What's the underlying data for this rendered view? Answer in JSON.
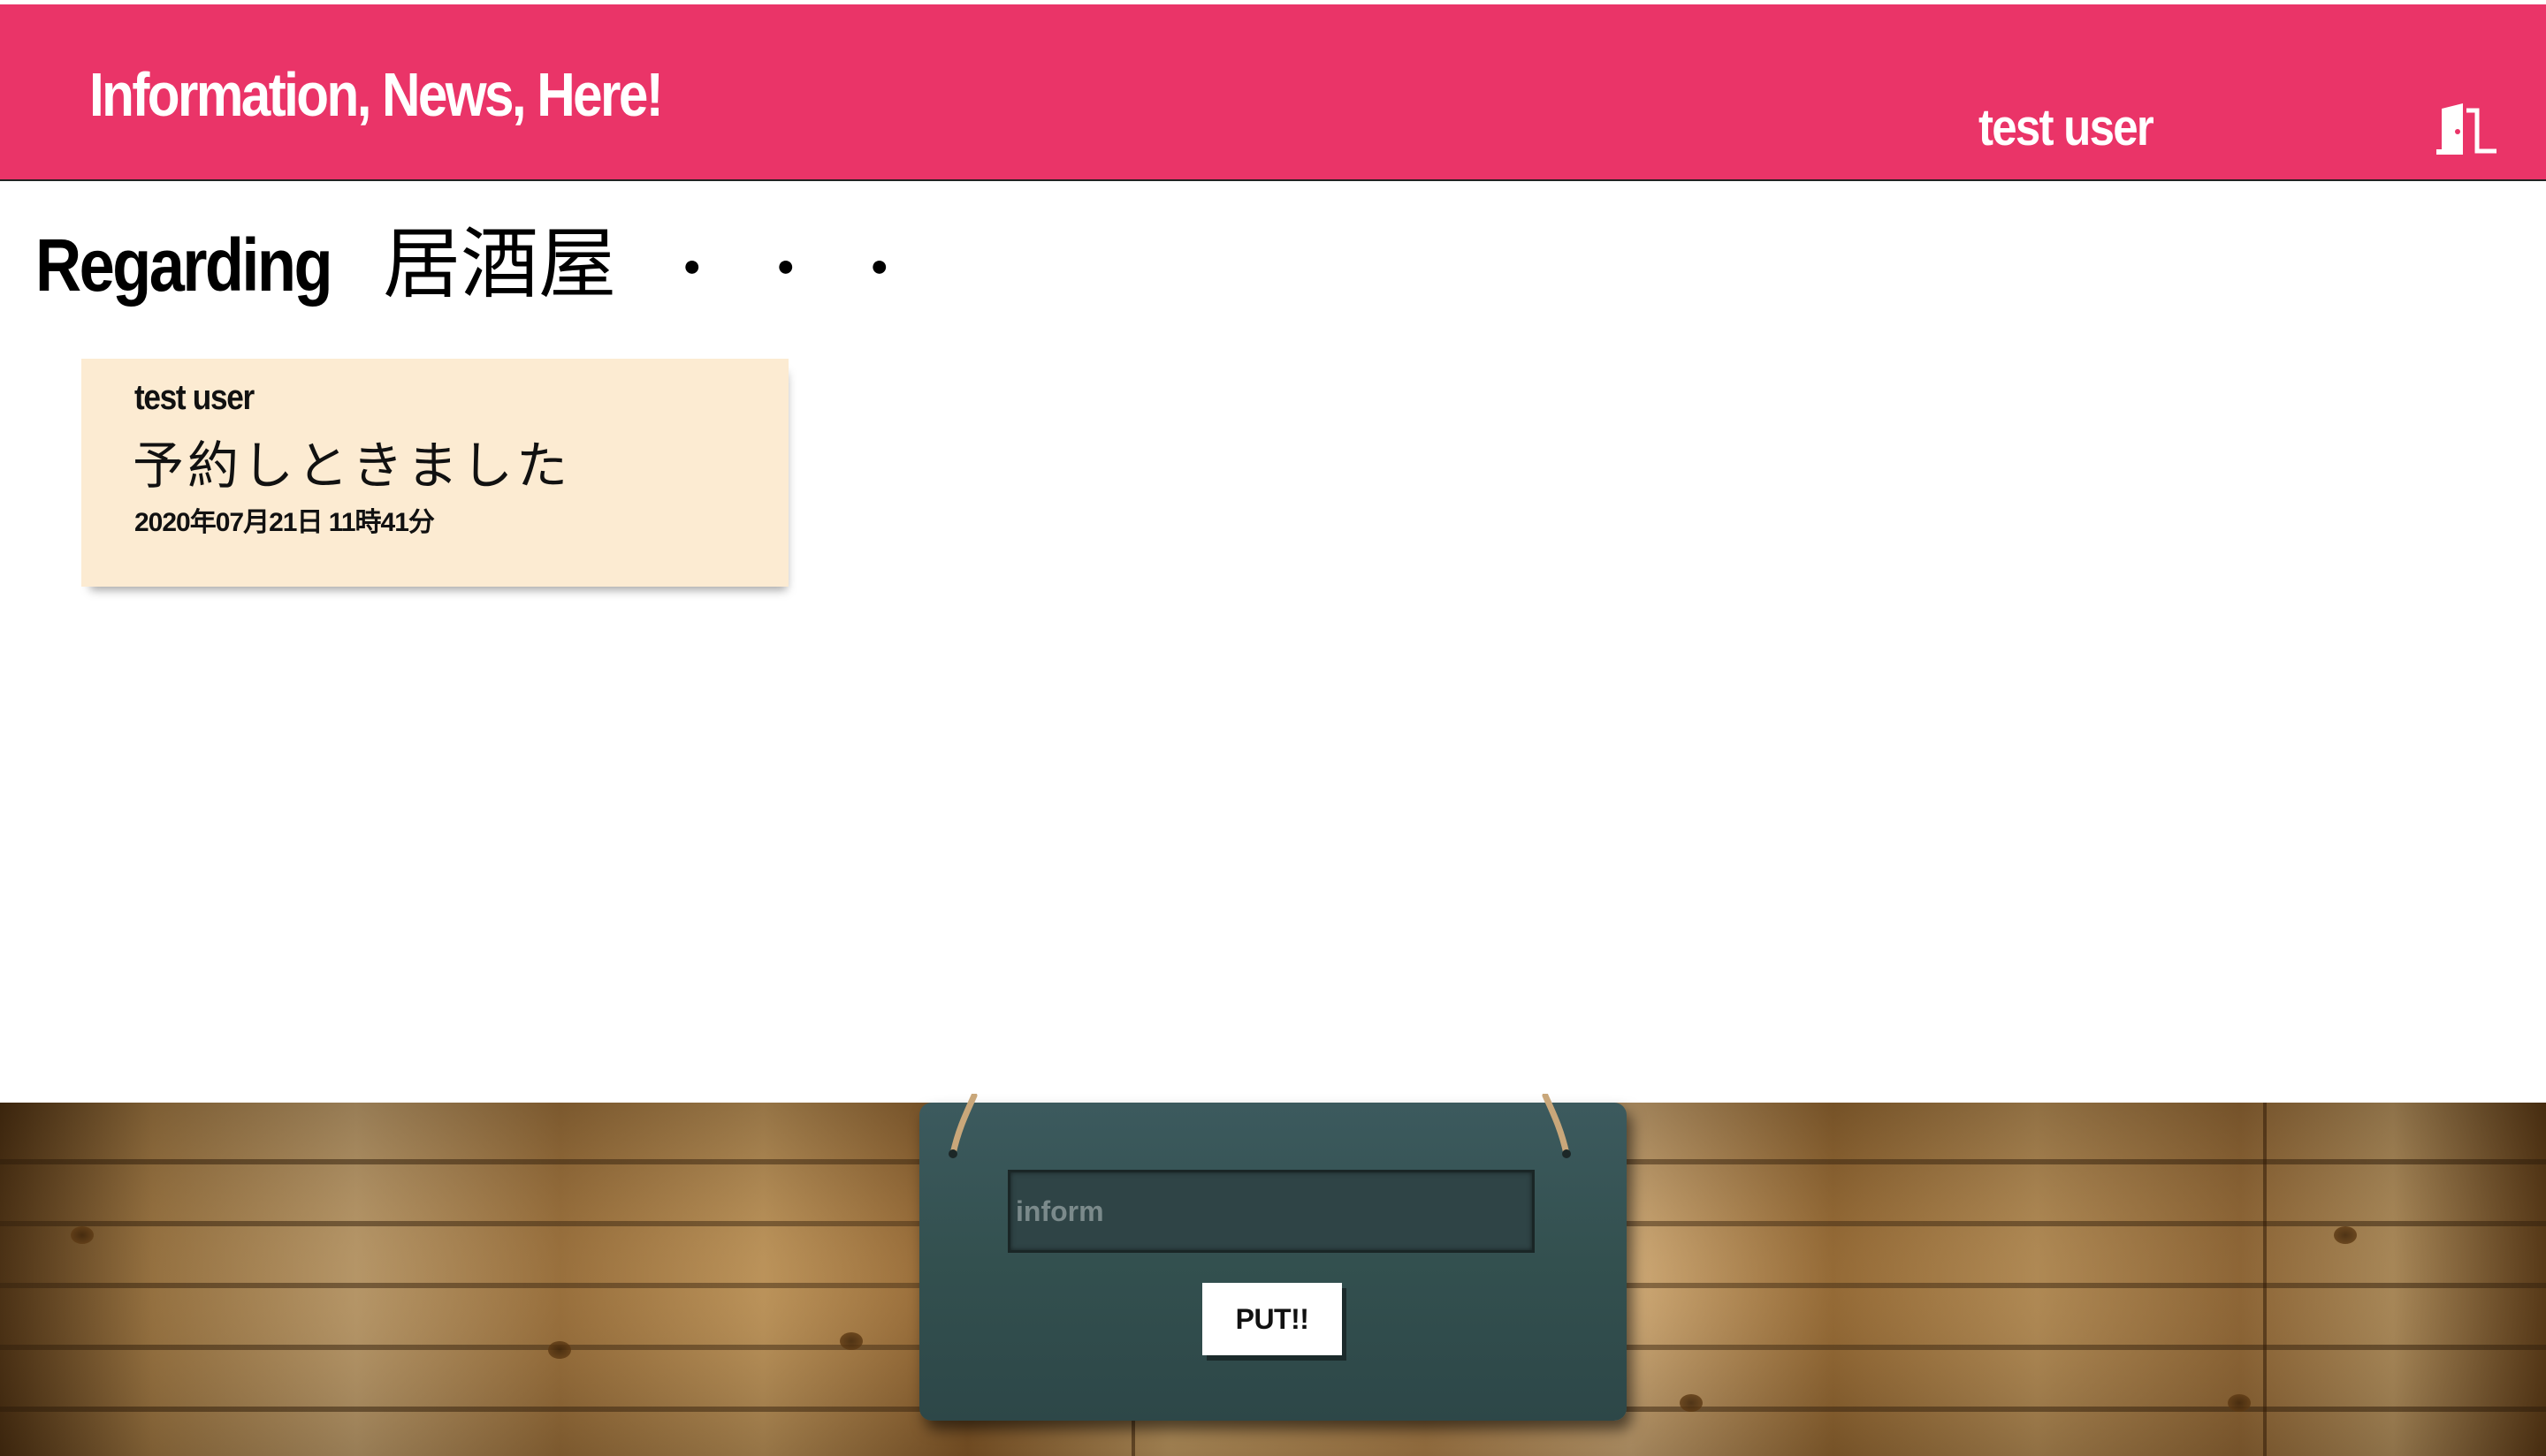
{
  "header": {
    "brand": "Information, News, Here!",
    "username": "test user",
    "logout_icon": "door-exit-icon"
  },
  "page": {
    "title_prefix": "Regarding",
    "topic": "居酒屋",
    "title_suffix": "・・・"
  },
  "posts": [
    {
      "author": "test user",
      "message": "予約しときました",
      "time": "2020年07月21日 11時41分"
    }
  ],
  "form": {
    "placeholder": "inform",
    "value": "",
    "submit_label": "PUT!!"
  },
  "colors": {
    "header": "#ea3468",
    "note": "#fcebd2",
    "board": "#3c5a5e"
  }
}
